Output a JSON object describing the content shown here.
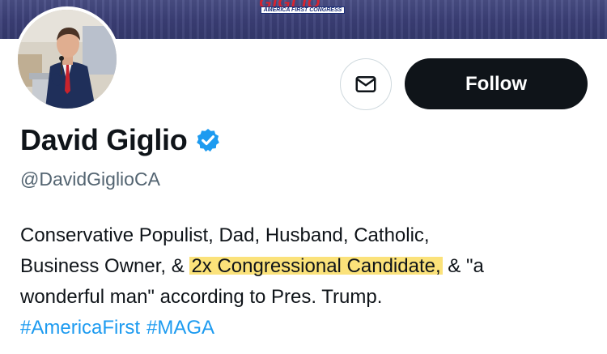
{
  "banner": {
    "logo_word": "GIGLIO",
    "logo_tagline": "AMERICA FIRST CONGRESS"
  },
  "profile": {
    "display_name": "David Giglio",
    "handle": "@DavidGiglioCA",
    "verified": true,
    "verified_color": "#1d9bf0"
  },
  "actions": {
    "message_icon": "mail-icon",
    "follow_label": "Follow"
  },
  "bio": {
    "line1": "Conservative Populist, Dad, Husband, Catholic,",
    "line2_prefix": "Business Owner, & ",
    "line2_highlight": "2x Congressional Candidate,",
    "line2_suffix": " & \"a",
    "line3": "wonderful man\" according to Pres. Trump.",
    "highlight_color": "#fbe27a"
  },
  "hashtags": [
    "#AmericaFirst",
    "#MAGA"
  ],
  "colors": {
    "text_primary": "#0f1419",
    "text_secondary": "#536471",
    "link": "#1d9bf0",
    "follow_bg": "#0f1419"
  }
}
